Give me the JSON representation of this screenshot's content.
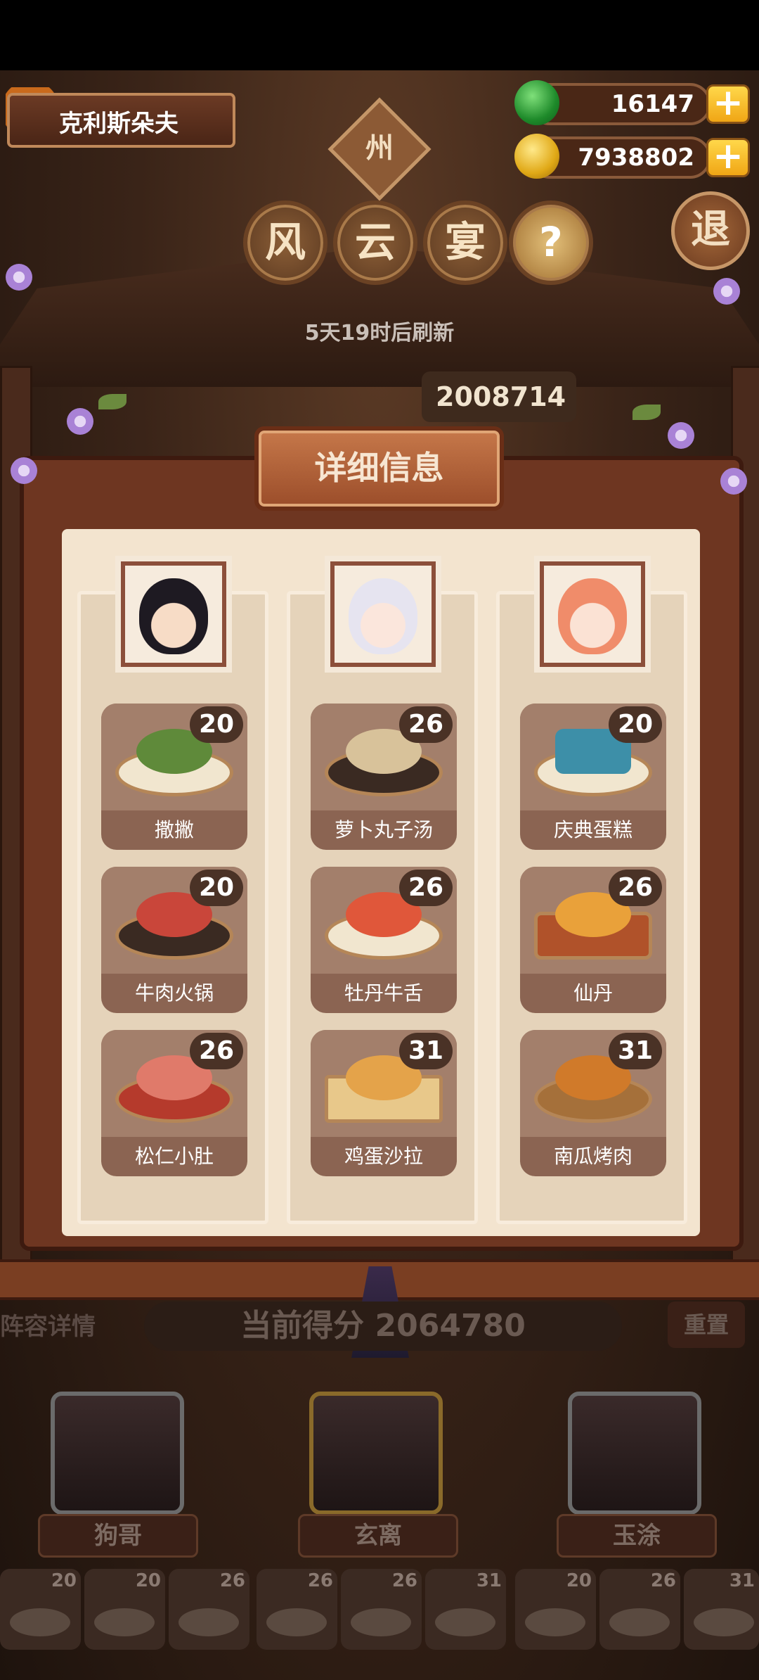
{
  "player": {
    "name": "克利斯朵夫"
  },
  "currency": {
    "jade": "16147",
    "coins": "7938802",
    "plus": "+"
  },
  "header": {
    "badge": "州",
    "title_chars": [
      "风",
      "云",
      "宴"
    ],
    "help": "?",
    "exit": "退",
    "refresh_text": "5天19时后刷新",
    "score_top": "2008714"
  },
  "panel": {
    "title": "详细信息",
    "columns": [
      {
        "character": "狗哥",
        "dishes": [
          {
            "name": "撒撇",
            "level": "20",
            "color": "#5f8a3a"
          },
          {
            "name": "牛肉火锅",
            "level": "20",
            "color": "#c9463a"
          },
          {
            "name": "松仁小肚",
            "level": "26",
            "color": "#b53a2c"
          }
        ]
      },
      {
        "character": "玄离",
        "dishes": [
          {
            "name": "萝卜丸子汤",
            "level": "26",
            "color": "#d8c29a"
          },
          {
            "name": "牡丹牛舌",
            "level": "26",
            "color": "#e0573a"
          },
          {
            "name": "鸡蛋沙拉",
            "level": "31",
            "color": "#e4a34a"
          }
        ]
      },
      {
        "character": "玉涂",
        "dishes": [
          {
            "name": "庆典蛋糕",
            "level": "20",
            "color": "#3d8fa8"
          },
          {
            "name": "仙丹",
            "level": "26",
            "color": "#e9a13a"
          },
          {
            "name": "南瓜烤肉",
            "level": "31",
            "color": "#d07a2a"
          }
        ]
      }
    ]
  },
  "bottom": {
    "lineup_label": "阵容详情",
    "current_score": "当前得分 2064780",
    "reset_label": "重置",
    "heroes": [
      "狗哥",
      "玄离",
      "玉涂"
    ],
    "mini_levels": [
      "20",
      "20",
      "26",
      "26",
      "26",
      "31",
      "20",
      "26",
      "31"
    ]
  }
}
